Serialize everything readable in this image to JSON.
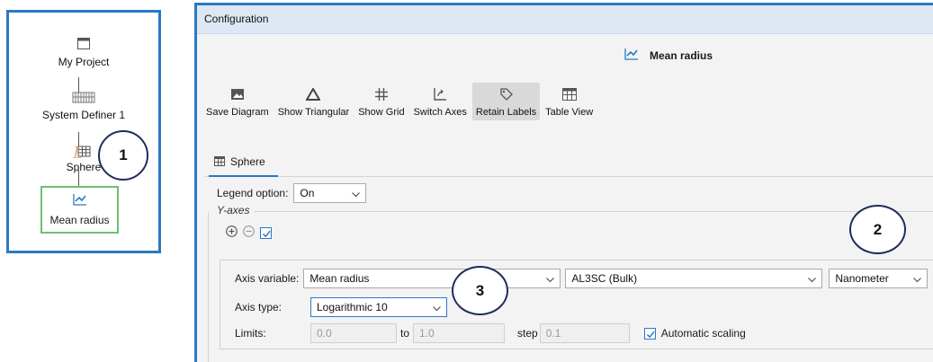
{
  "tree": {
    "nodes": [
      {
        "label": "My Project",
        "icon": "window-icon"
      },
      {
        "label": "System Definer 1",
        "icon": "system-definer-icon"
      },
      {
        "label": "Sphere",
        "icon": "sphere-grid-icon"
      },
      {
        "label": "Mean radius",
        "icon": "line-chart-icon"
      }
    ]
  },
  "callouts": [
    "1",
    "2",
    "3"
  ],
  "config": {
    "window_title": "Configuration",
    "heading": "Mean radius",
    "toolbar": [
      {
        "label": "Save Diagram",
        "icon": "image-icon"
      },
      {
        "label": "Show Triangular",
        "icon": "triangle-icon"
      },
      {
        "label": "Show Grid",
        "icon": "grid-hash-icon"
      },
      {
        "label": "Switch Axes",
        "icon": "switch-axes-icon"
      },
      {
        "label": "Retain Labels",
        "icon": "tag-icon",
        "active": true
      },
      {
        "label": "Table View",
        "icon": "table-icon"
      }
    ],
    "tab": {
      "label": "Sphere",
      "icon": "table-icon"
    },
    "legend": {
      "label": "Legend option:",
      "value": "On"
    },
    "y_axes": {
      "title": "Y-axes",
      "axis_variable_label": "Axis variable:",
      "axis_variable": "Mean radius",
      "phase": "AL3SC (Bulk)",
      "unit": "Nanometer",
      "axis_type_label": "Axis type:",
      "axis_type": "Logarithmic 10",
      "limits_label": "Limits:",
      "limit_min": "0.0",
      "to_label": "to",
      "limit_max": "1.0",
      "step_label": "step",
      "step": "0.1",
      "auto_scaling_label": "Automatic scaling",
      "auto_scaling_checked": true
    }
  },
  "colors": {
    "accent": "#2b79c2",
    "selected_node": "#6dbf72",
    "callout_border": "#1f2c5c"
  }
}
